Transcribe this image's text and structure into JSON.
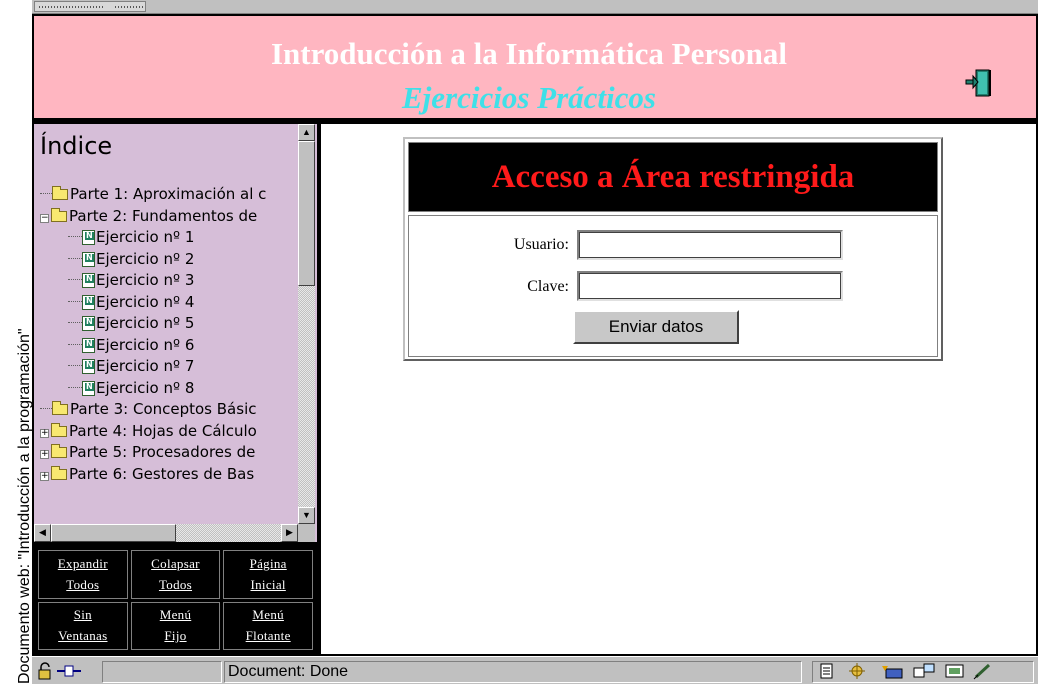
{
  "caption": "Documento web: \"Introducción a la programación\"",
  "banner": {
    "title": "Introducción a la Informática Personal",
    "subtitle": "Ejercicios Prácticos"
  },
  "index": {
    "heading": "Índice",
    "items": [
      {
        "label": "Parte 1: Aproximación al c",
        "type": "folder",
        "level": 0,
        "expander": "none"
      },
      {
        "label": "Parte 2: Fundamentos de",
        "type": "folder",
        "level": 0,
        "expander": "minus"
      },
      {
        "label": "Ejercicio nº 1",
        "type": "doc",
        "level": 1
      },
      {
        "label": "Ejercicio nº 2",
        "type": "doc",
        "level": 1
      },
      {
        "label": "Ejercicio nº 3",
        "type": "doc",
        "level": 1
      },
      {
        "label": "Ejercicio nº 4",
        "type": "doc",
        "level": 1
      },
      {
        "label": "Ejercicio nº 5",
        "type": "doc",
        "level": 1
      },
      {
        "label": "Ejercicio nº 6",
        "type": "doc",
        "level": 1
      },
      {
        "label": "Ejercicio nº 7",
        "type": "doc",
        "level": 1
      },
      {
        "label": "Ejercicio nº 8",
        "type": "doc",
        "level": 1
      },
      {
        "label": "Parte 3: Conceptos Básic",
        "type": "folder",
        "level": 0,
        "expander": "none"
      },
      {
        "label": "Parte 4: Hojas de Cálculo",
        "type": "folder",
        "level": 0,
        "expander": "plus"
      },
      {
        "label": "Parte 5: Procesadores de",
        "type": "folder",
        "level": 0,
        "expander": "plus"
      },
      {
        "label": "Parte 6: Gestores de Bas",
        "type": "folder",
        "level": 0,
        "expander": "plus"
      }
    ]
  },
  "nav": [
    {
      "line1": "Expandir",
      "line2": "Todos"
    },
    {
      "line1": "Colapsar",
      "line2": "Todos"
    },
    {
      "line1": "Página",
      "line2": "Inicial"
    },
    {
      "line1": "Sin",
      "line2": "Ventanas"
    },
    {
      "line1": "Menú",
      "line2": "Fijo"
    },
    {
      "line1": "Menú",
      "line2": "Flotante"
    }
  ],
  "login": {
    "title": "Acceso a Área restringida",
    "user_label": "Usuario:",
    "user_value": "",
    "password_label": "Clave:",
    "password_value": "",
    "submit_label": "Enviar datos"
  },
  "status": {
    "text": "Document: Done"
  },
  "colors": {
    "banner_bg": "#ffb6c1",
    "title": "#ffffff",
    "subtitle": "#3fe0e8",
    "index_bg": "#d6bed8",
    "login_title": "#ff1a1a"
  },
  "icons": [
    "exit-door-icon",
    "lock-icon",
    "connection-icon",
    "folder-icon",
    "document-icon",
    "status-tray-icons"
  ]
}
